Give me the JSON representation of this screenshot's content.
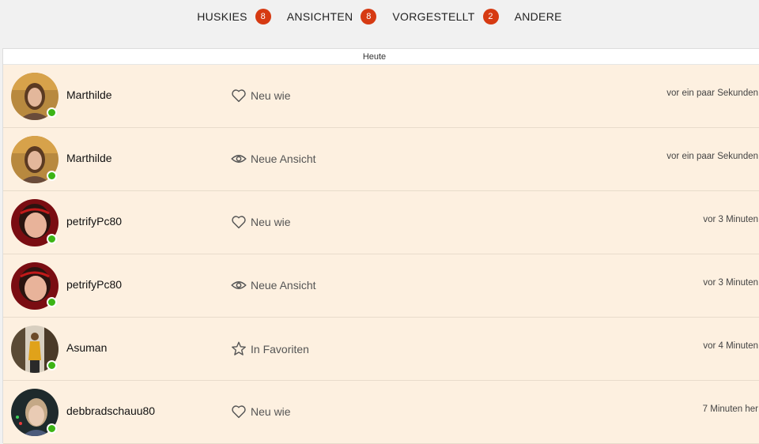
{
  "tabs": [
    {
      "label": "HUSKIES",
      "count": "8"
    },
    {
      "label": "ANSICHTEN",
      "count": "8"
    },
    {
      "label": "VORGESTELLT",
      "count": "2"
    },
    {
      "label": "ANDERE",
      "count": ""
    }
  ],
  "section_header": "Heute",
  "colors": {
    "badge": "#d63a12",
    "online": "#3cb415",
    "panel_bg": "#fdf0e0"
  },
  "notifications": [
    {
      "username": "Marthilde",
      "action": "Neu wie",
      "icon": "heart-icon",
      "time": "vor ein paar Sekunden"
    },
    {
      "username": "Marthilde",
      "action": "Neue Ansicht",
      "icon": "eye-icon",
      "time": "vor ein paar Sekunden"
    },
    {
      "username": "petrifyPc80",
      "action": "Neu wie",
      "icon": "heart-icon",
      "time": "vor 3 Minuten"
    },
    {
      "username": "petrifyPc80",
      "action": "Neue Ansicht",
      "icon": "eye-icon",
      "time": "vor 3 Minuten"
    },
    {
      "username": "Asuman",
      "action": "In Favoriten",
      "icon": "star-icon",
      "time": "vor 4 Minuten"
    },
    {
      "username": "debbradschauu80",
      "action": "Neu wie",
      "icon": "heart-icon",
      "time": "7 Minuten her"
    }
  ]
}
